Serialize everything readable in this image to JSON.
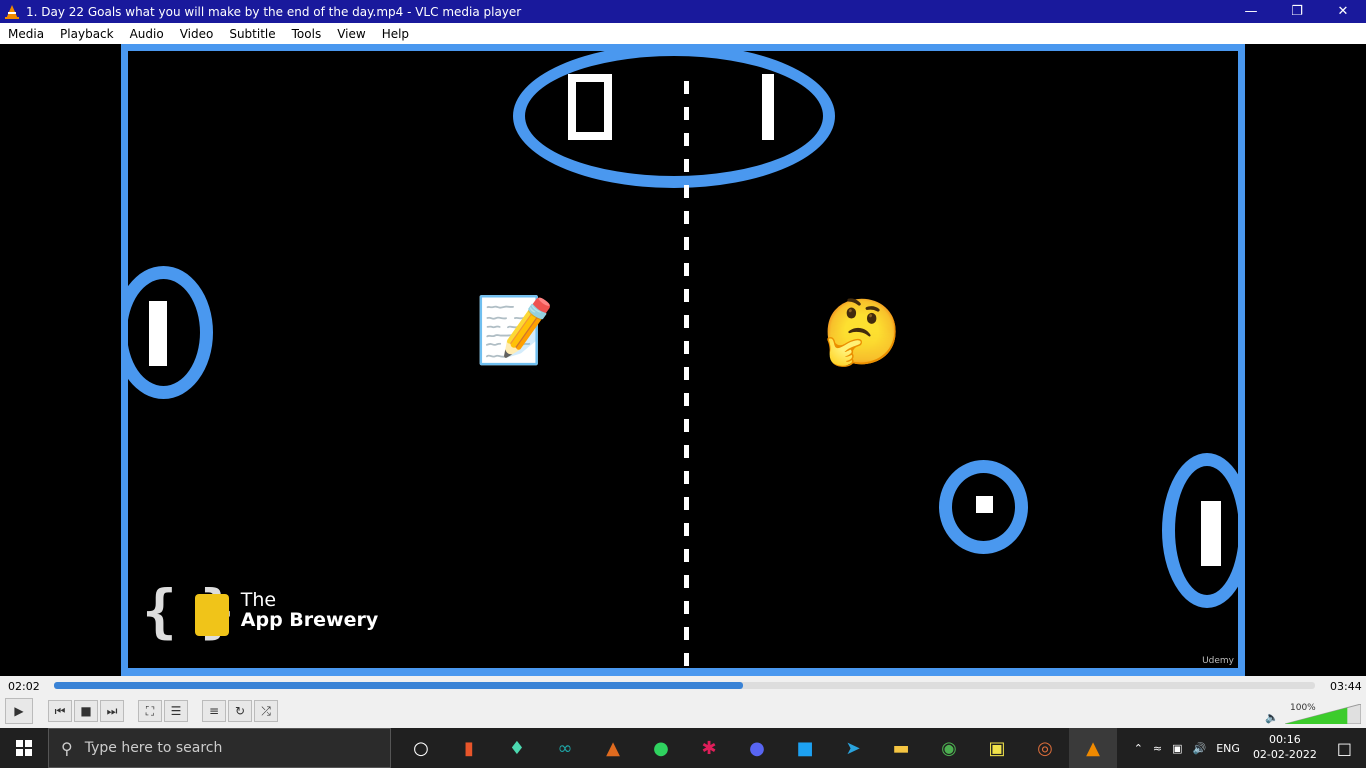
{
  "window": {
    "title": "1. Day 22 Goals what you will make by the end of the day.mp4 - VLC media player"
  },
  "menubar": {
    "items": [
      "Media",
      "Playback",
      "Audio",
      "Video",
      "Subtitle",
      "Tools",
      "View",
      "Help"
    ]
  },
  "video": {
    "logo_line1": "The",
    "logo_line2": "App Brewery",
    "watermark": "Udemy",
    "score_right": "I"
  },
  "controls": {
    "elapsed": "02:02",
    "total": "03:44",
    "progress": 0.546,
    "volume_label": "100%",
    "volume": 1.0
  },
  "taskbar": {
    "search_placeholder": "Type here to search",
    "language": "ENG",
    "time": "00:16",
    "date": "02-02-2022"
  },
  "colors": {
    "accent": "#4a98ef",
    "title_bg": "#19199c",
    "seek": "#3a83d6"
  }
}
